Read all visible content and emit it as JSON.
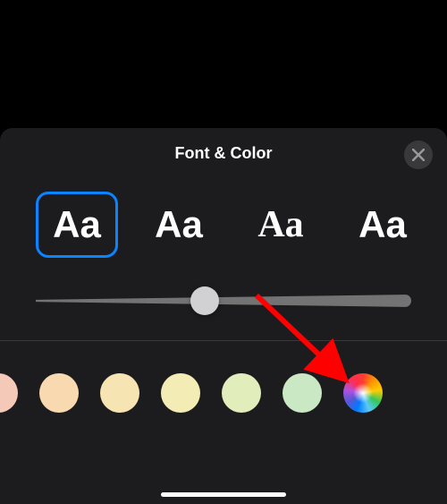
{
  "sheet": {
    "title": "Font & Color",
    "fonts": [
      {
        "sample": "Aa",
        "selected": true
      },
      {
        "sample": "Aa",
        "selected": false
      },
      {
        "sample": "Aa",
        "selected": false
      },
      {
        "sample": "Aa",
        "selected": false
      }
    ],
    "slider": {
      "position_percent": 45
    },
    "colors": [
      "#f5c9b8",
      "#f8d9b0",
      "#f7e4b3",
      "#f3ecb5",
      "#e1edbb",
      "#c9e8c3"
    ]
  },
  "annotation": {
    "arrow_color": "#ff0000"
  }
}
